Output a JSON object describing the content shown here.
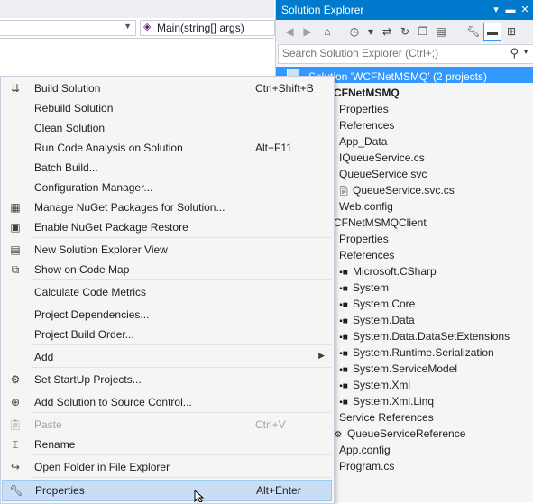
{
  "editor": {
    "nav_left_value": "",
    "nav_right_value": "Main(string[] args)"
  },
  "solution_explorer": {
    "title": "Solution Explorer",
    "search_placeholder": "Search Solution Explorer (Ctrl+;)",
    "toolbar_icons": [
      "back-icon",
      "forward-icon",
      "home-icon",
      "history-icon",
      "sync-icon",
      "refresh-icon",
      "collapse-all-icon",
      "show-all-files-icon",
      "properties-icon",
      "preview-selected-icon",
      "class-view-icon"
    ],
    "tree": [
      {
        "label": "Solution 'WCFNetMSMQ' (2 projects)",
        "selected": true
      },
      {
        "label": "CFNetMSMQ",
        "bold": true
      },
      {
        "label": "Properties"
      },
      {
        "label": "References"
      },
      {
        "label": "App_Data"
      },
      {
        "label": "IQueueService.cs"
      },
      {
        "label": "QueueService.svc"
      },
      {
        "label": "QueueService.svc.cs"
      },
      {
        "label": "Web.config"
      },
      {
        "label": "CFNetMSMQClient"
      },
      {
        "label": "Properties"
      },
      {
        "label": "References"
      },
      {
        "label": "Microsoft.CSharp"
      },
      {
        "label": "System"
      },
      {
        "label": "System.Core"
      },
      {
        "label": "System.Data"
      },
      {
        "label": "System.Data.DataSetExtensions"
      },
      {
        "label": "System.Runtime.Serialization"
      },
      {
        "label": "System.ServiceModel"
      },
      {
        "label": "System.Xml"
      },
      {
        "label": "System.Xml.Linq"
      },
      {
        "label": "Service References"
      },
      {
        "label": "QueueServiceReference"
      },
      {
        "label": "App.config"
      },
      {
        "label": "Program.cs"
      }
    ]
  },
  "context_menu": {
    "items": [
      {
        "label": "Build Solution",
        "shortcut": "Ctrl+Shift+B",
        "icon": "build-icon"
      },
      {
        "label": "Rebuild Solution",
        "shortcut": ""
      },
      {
        "label": "Clean Solution",
        "shortcut": ""
      },
      {
        "label": "Run Code Analysis on Solution",
        "shortcut": "Alt+F11"
      },
      {
        "label": "Batch Build...",
        "shortcut": ""
      },
      {
        "label": "Configuration Manager...",
        "shortcut": ""
      },
      {
        "label": "Manage NuGet Packages for Solution...",
        "shortcut": "",
        "icon": "nuget-icon"
      },
      {
        "label": "Enable NuGet Package Restore",
        "shortcut": "",
        "icon": "package-restore-icon"
      },
      {
        "label": "New Solution Explorer View",
        "shortcut": "",
        "icon": "new-view-icon"
      },
      {
        "label": "Show on Code Map",
        "shortcut": "",
        "icon": "code-map-icon"
      },
      {
        "label": "Calculate Code Metrics",
        "shortcut": ""
      },
      {
        "label": "Project Dependencies...",
        "shortcut": ""
      },
      {
        "label": "Project Build Order...",
        "shortcut": ""
      },
      {
        "label": "Add",
        "shortcut": ""
      },
      {
        "label": "Set StartUp Projects...",
        "shortcut": "",
        "icon": "gear-icon"
      },
      {
        "label": "Add Solution to Source Control...",
        "shortcut": "",
        "icon": "source-control-icon"
      },
      {
        "label": "Paste",
        "shortcut": "Ctrl+V",
        "icon": "paste-icon",
        "disabled": true
      },
      {
        "label": "Rename",
        "shortcut": "",
        "icon": "rename-icon"
      },
      {
        "label": "Open Folder in File Explorer",
        "shortcut": "",
        "icon": "open-folder-icon"
      },
      {
        "label": "Properties",
        "shortcut": "Alt+Enter",
        "icon": "wrench-icon",
        "highlighted": true
      }
    ]
  }
}
